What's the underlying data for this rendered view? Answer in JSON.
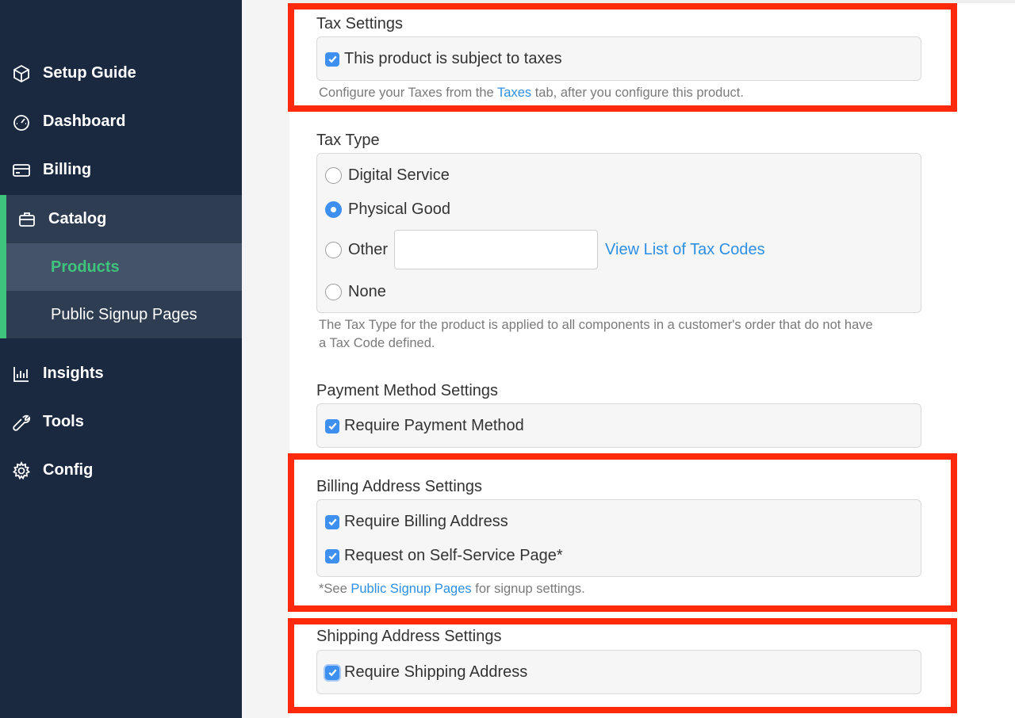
{
  "sidebar": {
    "items": [
      {
        "label": "Setup Guide"
      },
      {
        "label": "Dashboard"
      },
      {
        "label": "Billing"
      },
      {
        "label": "Catalog"
      },
      {
        "label": "Insights"
      },
      {
        "label": "Tools"
      },
      {
        "label": "Config"
      }
    ],
    "catalog_sub": [
      {
        "label": "Products",
        "active": true
      },
      {
        "label": "Public Signup Pages"
      }
    ]
  },
  "tax_settings": {
    "title": "Tax Settings",
    "checkbox_label": "This product is subject to taxes",
    "checked": true,
    "help_prefix": "Configure your Taxes from the ",
    "help_link": "Taxes",
    "help_suffix": " tab, after you configure this product."
  },
  "tax_type": {
    "title": "Tax Type",
    "options": [
      {
        "label": "Digital Service",
        "checked": false
      },
      {
        "label": "Physical Good",
        "checked": true
      },
      {
        "label": "Other",
        "checked": false
      },
      {
        "label": "None",
        "checked": false
      }
    ],
    "other_value": "",
    "codes_link": "View List of Tax Codes",
    "help_line1": "The Tax Type for the product is applied to all components in a customer's order that do not have",
    "help_line2": "a Tax Code defined."
  },
  "payment_method": {
    "title": "Payment Method Settings",
    "checkbox_label": "Require Payment Method",
    "checked": true
  },
  "billing_address": {
    "title": "Billing Address Settings",
    "options": [
      {
        "label": "Require Billing Address",
        "checked": true
      },
      {
        "label": "Request on Self-Service Page*",
        "checked": true
      }
    ],
    "help_prefix": "*See ",
    "help_link": "Public Signup Pages",
    "help_suffix": " for signup settings."
  },
  "shipping_address": {
    "title": "Shipping Address Settings",
    "checkbox_label": "Require Shipping Address",
    "checked": true
  },
  "colors": {
    "sidebar_bg": "#1b2940",
    "accent_green": "#3fc47c",
    "checkbox_blue": "#3d8ff0",
    "link_blue": "#2d8fe3",
    "highlight_red": "#ff2a0c"
  }
}
